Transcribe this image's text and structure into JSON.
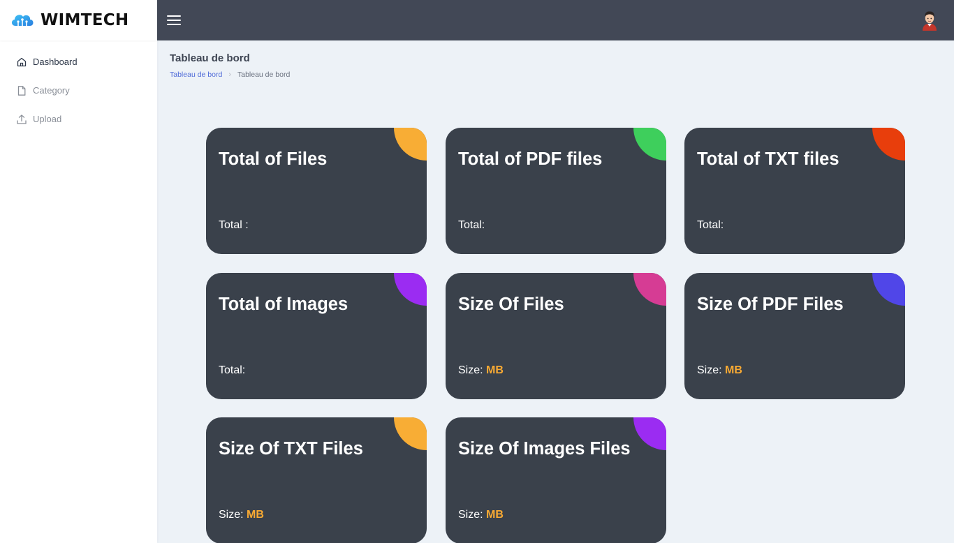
{
  "brand": {
    "name": "WIMTECH"
  },
  "sidebar": {
    "items": [
      {
        "label": "Dashboard",
        "icon": "home-icon"
      },
      {
        "label": "Category",
        "icon": "file-icon"
      },
      {
        "label": "Upload",
        "icon": "upload-icon"
      }
    ]
  },
  "header": {
    "title": "Tableau de bord",
    "breadcrumb": {
      "link": "Tableau de bord",
      "current": "Tableau de bord"
    }
  },
  "cards": [
    {
      "title": "Total of Files",
      "label": "Total :",
      "unit": "",
      "accent": "#f8ad35"
    },
    {
      "title": "Total of PDF files",
      "label": "Total:",
      "unit": "",
      "accent": "#3ecf5c"
    },
    {
      "title": "Total of TXT files",
      "label": "Total:",
      "unit": "",
      "accent": "#e83e0c"
    },
    {
      "title": "Total of Images",
      "label": "Total:",
      "unit": "",
      "accent": "#9b2cf2"
    },
    {
      "title": "Size Of Files",
      "label": "Size: ",
      "unit": "MB",
      "accent": "#d63c94"
    },
    {
      "title": "Size Of PDF Files",
      "label": "Size: ",
      "unit": "MB",
      "accent": "#5046e8"
    },
    {
      "title": "Size Of TXT Files",
      "label": "Size: ",
      "unit": "MB",
      "accent": "#f8ad35"
    },
    {
      "title": "Size Of Images Files",
      "label": "Size: ",
      "unit": "MB",
      "accent": "#9b2cf2"
    }
  ],
  "colors": {
    "topbar": "#424856",
    "card_bg": "#3a414b",
    "unit_text": "#f9aa33",
    "breadcrumb_link": "#4f6bd8"
  }
}
